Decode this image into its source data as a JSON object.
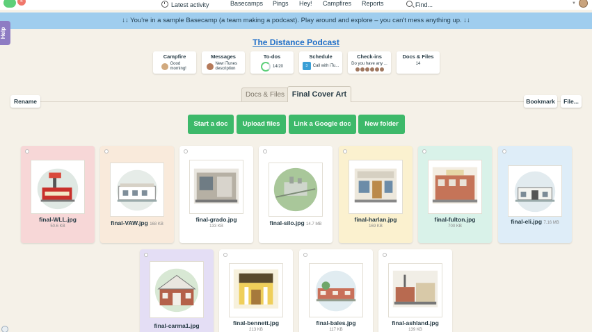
{
  "nav": {
    "notifications_badge": "4",
    "latest_activity": "Latest activity",
    "basecamps": "Basecamps",
    "pings": "Pings",
    "hey": "Hey!",
    "campfires": "Campfires",
    "reports": "Reports",
    "find": "Find..."
  },
  "banner": {
    "text": "↓↓ You're in a sample Basecamp (a team making a podcast). Play around and explore – you can't mess anything up. ↓↓"
  },
  "help": {
    "label": "Help"
  },
  "project": {
    "title": "The Distance Podcast"
  },
  "tools": [
    {
      "name": "Campfire",
      "body": "Good morning!"
    },
    {
      "name": "Messages",
      "body": "New iTunes description"
    },
    {
      "name": "To-dos",
      "body": "14/20"
    },
    {
      "name": "Schedule",
      "body": "Call with iTu...",
      "cal_month": "Feb",
      "cal_day": "3"
    },
    {
      "name": "Check-ins",
      "body": "Do you have any ..."
    },
    {
      "name": "Docs & Files",
      "body": "14"
    }
  ],
  "toolbar": {
    "rename": "Rename",
    "bookmark": "Bookmark",
    "file_menu": "File...",
    "crumb_parent": "Docs & Files",
    "crumb_current": "Final Cover Art"
  },
  "actions": {
    "start_doc": "Start a doc",
    "upload_files": "Upload files",
    "link_google": "Link a Google doc",
    "new_folder": "New folder"
  },
  "files": [
    {
      "name": "final-WLL.jpg",
      "size": "50.6 KB",
      "bg": "#f7d7d7"
    },
    {
      "name": "final-VAW.jpg",
      "size": "168 KB",
      "bg": "#f9eadb"
    },
    {
      "name": "final-grado.jpg",
      "size": "133 KB",
      "bg": "#ffffff"
    },
    {
      "name": "final-silo.jpg",
      "size": "14.7 MB",
      "bg": "#ffffff"
    },
    {
      "name": "final-harlan.jpg",
      "size": "169 KB",
      "bg": "#fbf1cf"
    },
    {
      "name": "final-fulton.jpg",
      "size": "700 KB",
      "bg": "#d9f2e9"
    },
    {
      "name": "final-eli.jpg",
      "size": "7.16 MB",
      "bg": "#deedf8"
    },
    {
      "name": "final-carma1.jpg",
      "size": "",
      "bg": "#e4def5"
    },
    {
      "name": "final-bennett.jpg",
      "size": "213 KB",
      "bg": "#ffffff"
    },
    {
      "name": "final-bales.jpg",
      "size": "117 KB",
      "bg": "#ffffff"
    },
    {
      "name": "final-ashland.jpg",
      "size": "139 KB",
      "bg": "#ffffff"
    }
  ]
}
